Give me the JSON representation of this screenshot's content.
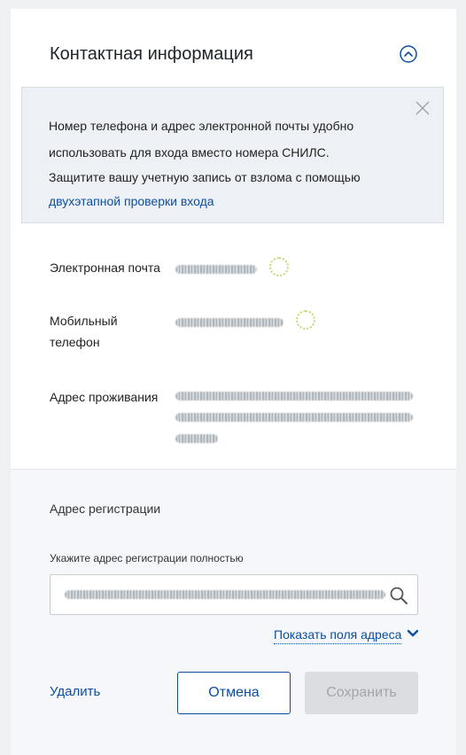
{
  "section": {
    "title": "Контактная информация"
  },
  "notice": {
    "line1": "Номер телефона и адрес электронной почты удобно",
    "line2": "использовать для входа вместо номера СНИЛС.",
    "line3": "Защитите вашу учетную запись от взлома с помощью",
    "link": "двухэтапной проверки входа"
  },
  "fields": {
    "email_label": "Электронная почта",
    "phone_label_1": "Мобильный",
    "phone_label_2": "телефон",
    "address_label": "Адрес проживания"
  },
  "registration": {
    "title": "Адрес регистрации",
    "input_label": "Укажите адрес регистрации полностью",
    "show_fields": "Показать поля адреса",
    "delete": "Удалить",
    "cancel": "Отмена",
    "save": "Сохранить"
  },
  "colors": {
    "link": "#0b4ea2",
    "notice_bg": "#edf1f5",
    "disabled_button": "#dbdde0"
  },
  "icons": {
    "collapse": "chevron-up-circle-icon",
    "close": "close-icon",
    "verified": "verified-icon",
    "search": "search-icon",
    "chevron": "chevron-down-icon"
  }
}
